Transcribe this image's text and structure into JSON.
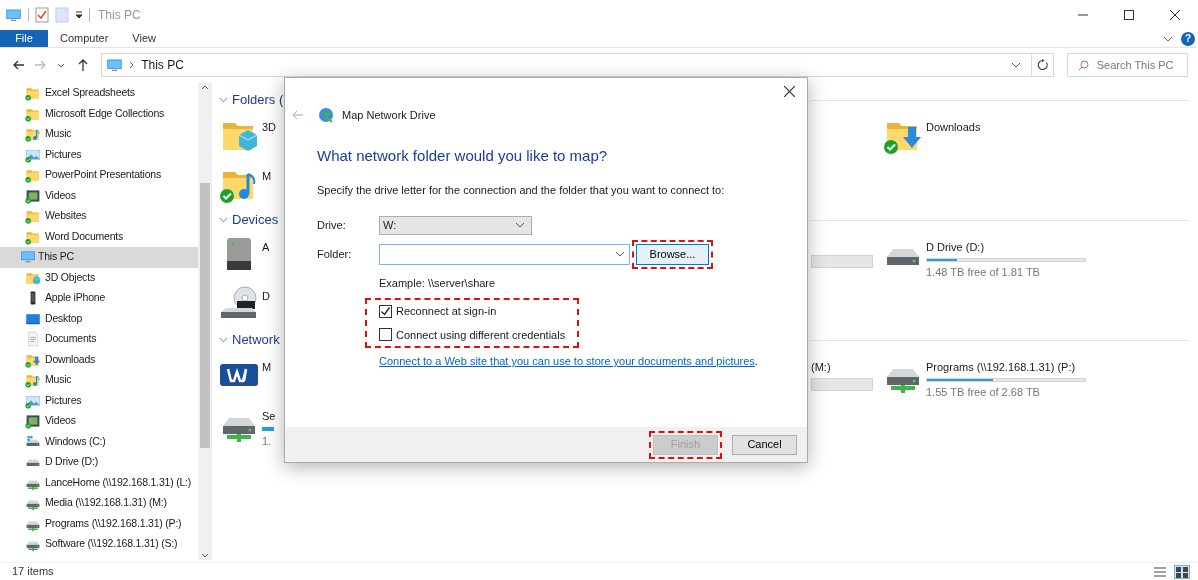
{
  "window": {
    "title": "This PC"
  },
  "ribbon": {
    "tabs": [
      {
        "label": "File",
        "selected": true
      },
      {
        "label": "Computer",
        "selected": false
      },
      {
        "label": "View",
        "selected": false
      }
    ],
    "help": "?"
  },
  "address": {
    "path": "This PC",
    "search_placeholder": "Search This PC"
  },
  "sidebar": {
    "sections": [
      {
        "children": [
          {
            "label": "Excel Spreadsheets",
            "kind": "folder",
            "synced": true,
            "selected": false
          },
          {
            "label": "Microsoft Edge Collections",
            "kind": "folder",
            "synced": true,
            "selected": false
          },
          {
            "label": "Music",
            "kind": "music",
            "synced": true,
            "selected": false
          },
          {
            "label": "Pictures",
            "kind": "pictures",
            "synced": true,
            "selected": false
          },
          {
            "label": "PowerPoint Presentations",
            "kind": "folder",
            "synced": true,
            "selected": false
          },
          {
            "label": "Videos",
            "kind": "videos",
            "synced": true,
            "selected": false
          },
          {
            "label": "Websites",
            "kind": "folder",
            "synced": true,
            "selected": false
          },
          {
            "label": "Word Documents",
            "kind": "folder",
            "synced": true,
            "selected": false
          }
        ]
      },
      {
        "label": "This PC",
        "kind": "pc",
        "synced": false,
        "selected": true,
        "children": [
          {
            "label": "3D Objects",
            "kind": "objects",
            "synced": false,
            "selected": false
          },
          {
            "label": "Apple iPhone",
            "kind": "phone",
            "synced": false,
            "selected": false
          },
          {
            "label": "Desktop",
            "kind": "desktop",
            "synced": false,
            "selected": false
          },
          {
            "label": "Documents",
            "kind": "documents",
            "synced": false,
            "selected": false
          },
          {
            "label": "Downloads",
            "kind": "downloads",
            "synced": true,
            "selected": false
          },
          {
            "label": "Music",
            "kind": "music",
            "synced": true,
            "selected": false
          },
          {
            "label": "Pictures",
            "kind": "pictures",
            "synced": true,
            "selected": false
          },
          {
            "label": "Videos",
            "kind": "videos",
            "synced": true,
            "selected": false
          },
          {
            "label": "Windows (C:)",
            "kind": "windows-drive",
            "synced": false,
            "selected": false
          },
          {
            "label": "D Drive (D:)",
            "kind": "drive",
            "synced": false,
            "selected": false
          },
          {
            "label": "LanceHome (\\\\192.168.1.31) (L:)",
            "kind": "netdrive",
            "synced": false,
            "selected": false
          },
          {
            "label": "Media (\\\\192.168.1.31) (M:)",
            "kind": "netdrive",
            "synced": false,
            "selected": false
          },
          {
            "label": "Programs (\\\\192.168.1.31) (P:)",
            "kind": "netdrive",
            "synced": false,
            "selected": false
          },
          {
            "label": "Software (\\\\192.168.1.31) (S:)",
            "kind": "netdrive",
            "synced": false,
            "selected": false
          }
        ]
      }
    ]
  },
  "content": {
    "sections": [
      {
        "header": "Folders (",
        "rows": [
          {
            "left": {
              "label": "3D",
              "kind": "objects",
              "synced": false
            },
            "right": {
              "label": "Downloads",
              "kind": "downloads",
              "synced": true
            }
          },
          {
            "left": {
              "label": "M",
              "kind": "music",
              "synced": true
            }
          }
        ]
      },
      {
        "header": "Devices",
        "rows": [
          {
            "left": {
              "label": "A",
              "kind": "device",
              "synced": false
            },
            "partial": {
              "kind": "bar"
            },
            "right": {
              "label": "D Drive (D:)",
              "kind": "drive",
              "synced": false,
              "level": 0.19,
              "detail": "1.48 TB free of 1.81 TB"
            }
          },
          {
            "left": {
              "label": "D",
              "kind": "dvd",
              "synced": false
            }
          }
        ]
      },
      {
        "header": "Network",
        "rows": [
          {
            "left": {
              "label": "M",
              "kind": "wd",
              "synced": false
            },
            "partial": {
              "label": "(M:)",
              "kind": "bar"
            },
            "right": {
              "label": "Programs (\\\\192.168.1.31) (P:)",
              "kind": "netdrive",
              "synced": false,
              "level": 0.42,
              "detail": "1.55 TB free of 2.68 TB"
            }
          },
          {
            "left": {
              "label": "Se",
              "kind": "netdrive",
              "synced": false,
              "detail": "1."
            }
          }
        ]
      }
    ]
  },
  "dialog": {
    "title": "Map Network Drive",
    "heading": "What network folder would you like to map?",
    "instruction": "Specify the drive letter for the connection and the folder that you want to connect to:",
    "drive_label": "Drive:",
    "drive_value": "W:",
    "folder_label": "Folder:",
    "browse": {
      "label": "Browse...",
      "highlighted": true
    },
    "example": "Example: \\\\server\\share",
    "options": [
      {
        "label": "Reconnect at sign-in",
        "checked": true
      },
      {
        "label": "Connect using different credentials",
        "checked": false
      }
    ],
    "options_highlighted": true,
    "web_link": "Connect to a Web site that you can use to store your documents and pictures",
    "web_link_suffix": ".",
    "buttons": [
      {
        "label": "Finish",
        "disabled": true,
        "highlighted": true
      },
      {
        "label": "Cancel",
        "disabled": false,
        "highlighted": false
      }
    ]
  },
  "status_bar": {
    "count": "17 items",
    "views": [
      {
        "kind": "details",
        "selected": false
      },
      {
        "kind": "tiles",
        "selected": true
      }
    ]
  }
}
